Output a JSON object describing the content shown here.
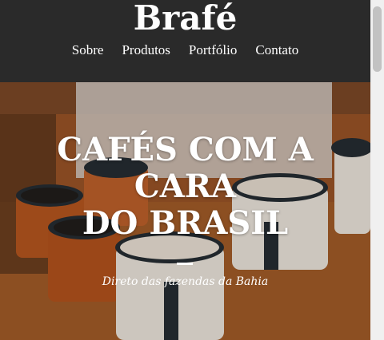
{
  "header": {
    "brand": "Brafé",
    "nav": [
      "Sobre",
      "Produtos",
      "Portfólio",
      "Contato"
    ]
  },
  "hero": {
    "headline_lines": [
      "CAFÉS COM A",
      "CARA",
      "DO BRASIL"
    ],
    "subtitle": "Direto das fazendas da Bahia"
  },
  "colors": {
    "header_bg": "#2a2a2a",
    "text": "#ffffff",
    "mug_enamel_orange": "#b8561e",
    "mug_enamel_white": "#f1ede6",
    "rim_dark": "#1f2a33"
  }
}
